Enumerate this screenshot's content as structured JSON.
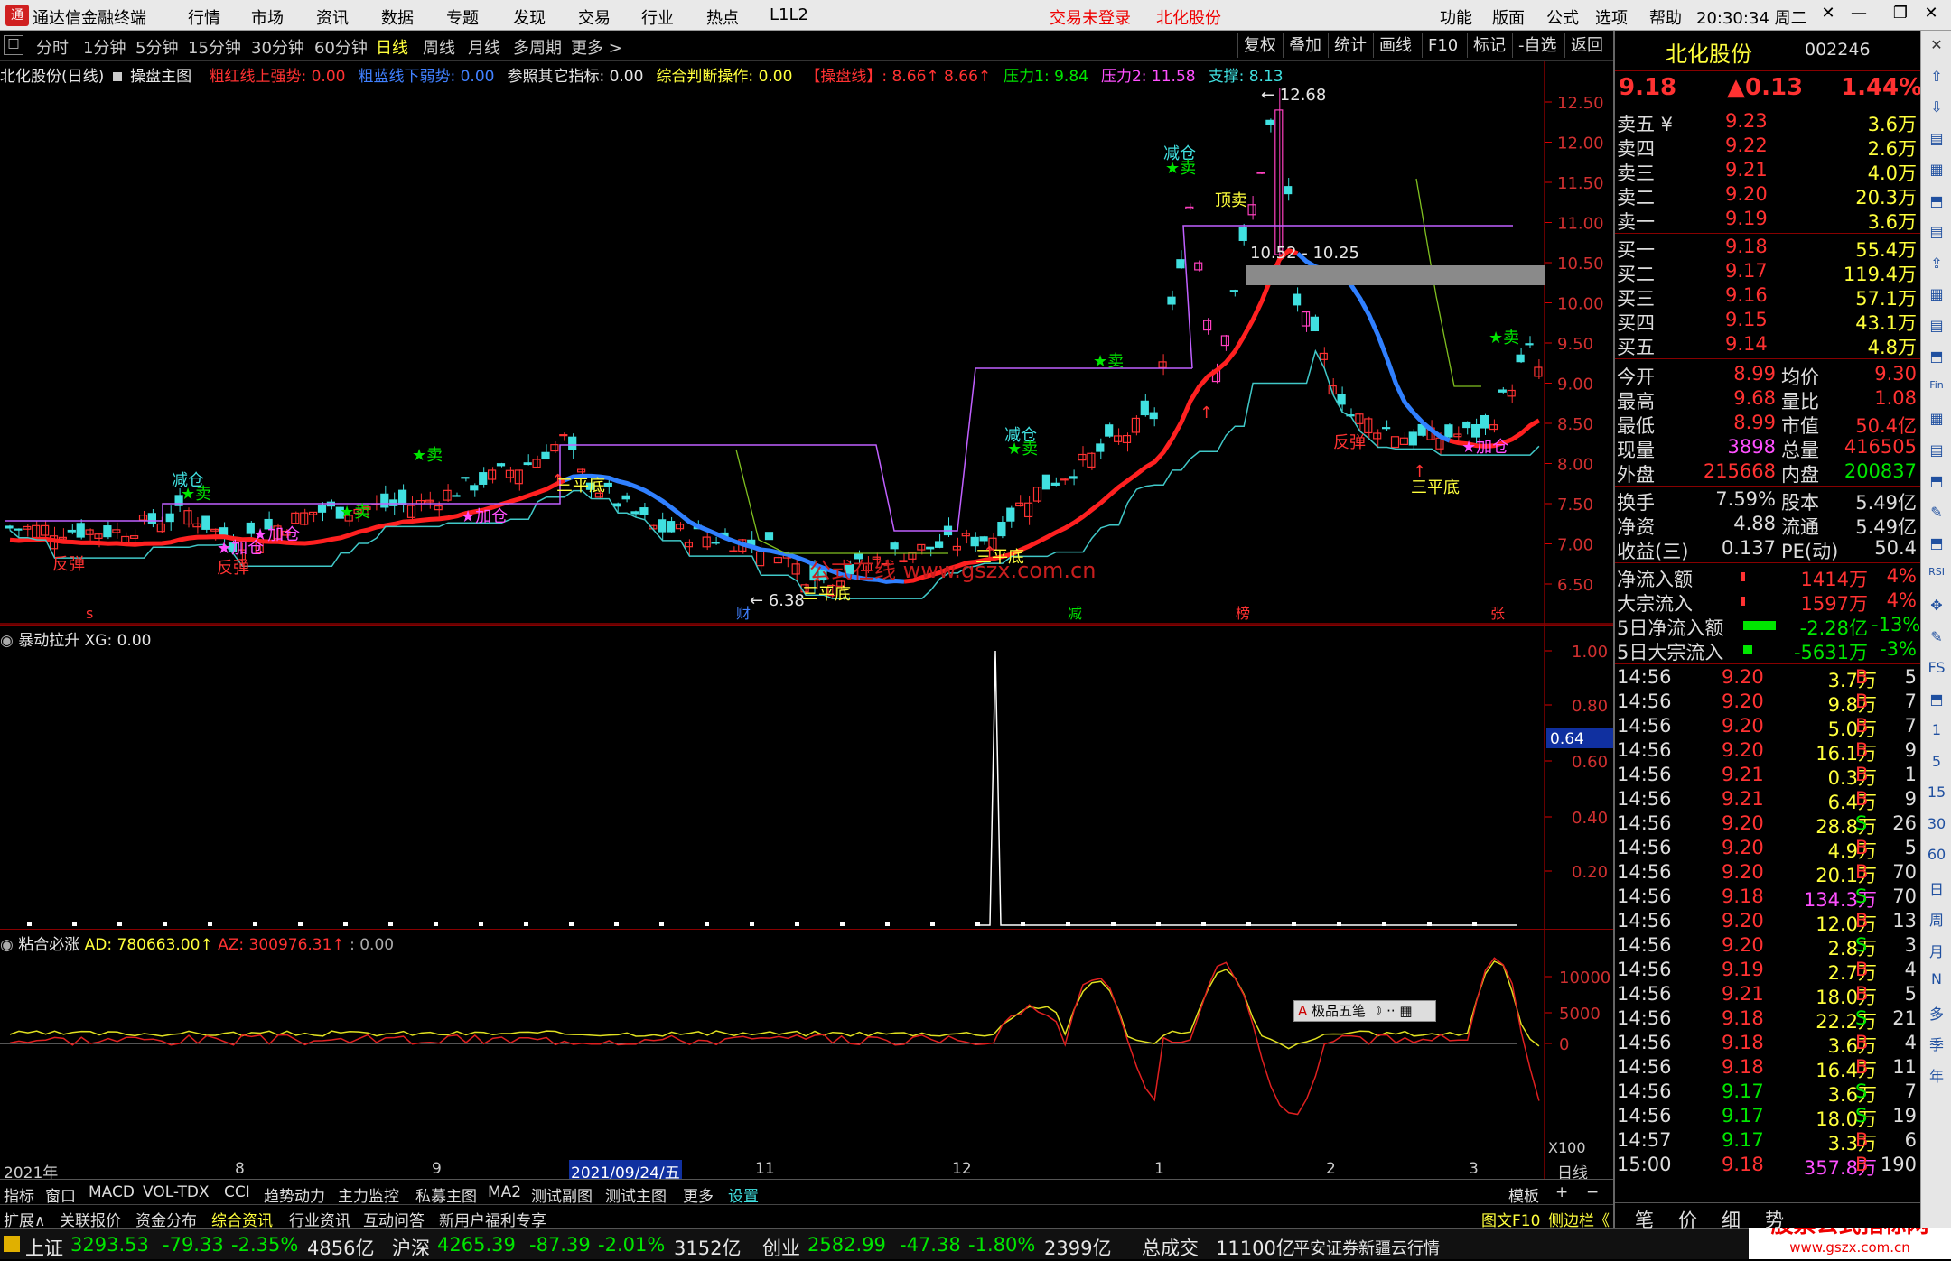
{
  "menubar": {
    "app_title": "通达信金融终端",
    "menus": [
      "行情",
      "市场",
      "资讯",
      "数据",
      "专题",
      "发现",
      "交易",
      "行业",
      "热点",
      "L1L2"
    ],
    "login_status": "交易未登录",
    "stock_name": "北化股份",
    "right_menus": [
      "功能",
      "版面",
      "公式",
      "选项",
      "帮助"
    ],
    "clock": "20:30:34",
    "weekday": "周二"
  },
  "toolbar": {
    "periods": [
      "分时",
      "1分钟",
      "5分钟",
      "15分钟",
      "30分钟",
      "60分钟",
      "日线",
      "周线",
      "月线",
      "多周期",
      "更多 >"
    ],
    "selected": "日线",
    "right_buttons": [
      "复权",
      "叠加",
      "统计",
      "画线",
      "F10",
      "标记",
      "-自选",
      "返回"
    ]
  },
  "main": {
    "stock_label": "北化股份(日线)",
    "formula": "操盘主图",
    "legend": [
      {
        "text": "粗红线上强势: 0.00",
        "color": "#ff3232"
      },
      {
        "text": "粗蓝线下弱势: 0.00",
        "color": "#4080ff"
      },
      {
        "text": "参照其它指标: 0.00",
        "color": "#e6e6e6"
      },
      {
        "text": "综合判断操作: 0.00",
        "color": "#ffff3c"
      },
      {
        "text": "【操盘线】: 8.66↑  8.66↑",
        "color": "#ff3232"
      },
      {
        "text": "压力1: 9.84",
        "color": "#00e600"
      },
      {
        "text": "压力2: 11.58",
        "color": "#ff50ff"
      },
      {
        "text": "支撑: 8.13",
        "color": "#40e0e0"
      }
    ],
    "yticks": [
      "12.50",
      "12.00",
      "11.50",
      "11.00",
      "10.50",
      "10.00",
      "9.50",
      "9.00",
      "8.50",
      "8.00",
      "7.50",
      "7.00",
      "6.50"
    ],
    "high_label": "12.68",
    "low_label": "6.38",
    "zone_label": "10.52 - 10.25",
    "watermark": "公式在线  www.gszx.com.cn",
    "annotations": [
      {
        "t": "减仓",
        "c": "#40e0e0"
      },
      {
        "t": "★卖",
        "c": "#00e600"
      },
      {
        "t": "反弹",
        "c": "#ff3232"
      },
      {
        "t": "★加仓",
        "c": "#ff50ff"
      },
      {
        "t": "★加仓",
        "c": "#ff50ff"
      },
      {
        "t": "反弹",
        "c": "#ff3232"
      },
      {
        "t": "★卖",
        "c": "#00e600"
      },
      {
        "t": "★卖",
        "c": "#00e600"
      },
      {
        "t": "★加仓",
        "c": "#ff50ff"
      },
      {
        "t": "三平底",
        "c": "#ffff3c"
      },
      {
        "t": "三平底",
        "c": "#ffff3c"
      },
      {
        "t": "三平底",
        "c": "#ffff3c"
      },
      {
        "t": "减仓",
        "c": "#40e0e0"
      },
      {
        "t": "★卖",
        "c": "#00e600"
      },
      {
        "t": "★卖",
        "c": "#00e600"
      },
      {
        "t": "减仓",
        "c": "#40e0e0"
      },
      {
        "t": "★卖",
        "c": "#00e600"
      },
      {
        "t": "顶卖",
        "c": "#ffff3c"
      },
      {
        "t": "反弹",
        "c": "#ff3232"
      },
      {
        "t": "三平底",
        "c": "#ffff3c"
      },
      {
        "t": "★加仓",
        "c": "#ff50ff"
      },
      {
        "t": "★卖",
        "c": "#00e600"
      }
    ],
    "markers": [
      {
        "t": "s",
        "c": "#ff3232"
      },
      {
        "t": "财",
        "c": "#4080ff"
      },
      {
        "t": "减",
        "c": "#00e600"
      },
      {
        "t": "榜",
        "c": "#ff3232"
      },
      {
        "t": "张",
        "c": "#ff3232"
      }
    ]
  },
  "ind1": {
    "title": "暴动拉升",
    "value": "XG: 0.00",
    "yticks": [
      "1.00",
      "0.80",
      "0.60",
      "0.40",
      "0.20"
    ],
    "cursor_value": "0.64"
  },
  "ind2": {
    "title": "粘合必涨",
    "ad": "AD: 780663.00↑",
    "az": "AZ: 300976.31↑",
    "extra": ": 0.00",
    "yticks": [
      "10000",
      "5000",
      "0"
    ],
    "scale": "X100",
    "ime": "极品五笔"
  },
  "dateaxis": {
    "labels": [
      "2021年",
      "8",
      "9",
      "2021/09/24/五",
      "11",
      "12",
      "1",
      "2",
      "3"
    ],
    "period": "日线"
  },
  "tabs": [
    "指标",
    "窗口",
    "MACD",
    "VOL-TDX",
    "CCI",
    "趋势动力",
    "主力监控",
    "私募主图",
    "MA2",
    "测试副图",
    "测试主图",
    "更多",
    "设置"
  ],
  "tabs_right": [
    "模板",
    "+",
    "−"
  ],
  "ext": [
    "扩展∧",
    "关联报价",
    "资金分布",
    "综合资讯",
    "行业资讯",
    "互动问答",
    "新用户福利专享"
  ],
  "ext_right": [
    "图文F10",
    "侧边栏《"
  ],
  "status": [
    {
      "n": "上证",
      "v": "3293.53",
      "ch": "-79.33",
      "pct": "-2.35%",
      "amt": "4856亿"
    },
    {
      "n": "沪深",
      "v": "4265.39",
      "ch": "-87.39",
      "pct": "-2.01%",
      "amt": "3152亿"
    },
    {
      "n": "创业",
      "v": "2582.99",
      "ch": "-47.38",
      "pct": "-1.80%",
      "amt": "2399亿"
    }
  ],
  "status_extra": {
    "label": "总成交",
    "value": "11100亿",
    "broker": "平安证券新疆云行情",
    "ad": "股票公式指标网",
    "ad_url": "www.gszx.com.cn"
  },
  "quote": {
    "name": "北化股份",
    "code": "002246",
    "price": "9.18",
    "change": "▲0.13",
    "pct": "1.44%",
    "sells": [
      {
        "l": "卖五 ¥",
        "p": "9.23",
        "v": "3.6万"
      },
      {
        "l": "卖四",
        "p": "9.22",
        "v": "2.6万"
      },
      {
        "l": "卖三",
        "p": "9.21",
        "v": "4.0万"
      },
      {
        "l": "卖二",
        "p": "9.20",
        "v": "20.3万"
      },
      {
        "l": "卖一",
        "p": "9.19",
        "v": "3.6万"
      }
    ],
    "buys": [
      {
        "l": "买一",
        "p": "9.18",
        "v": "55.4万"
      },
      {
        "l": "买二",
        "p": "9.17",
        "v": "119.4万"
      },
      {
        "l": "买三",
        "p": "9.16",
        "v": "57.1万"
      },
      {
        "l": "买四",
        "p": "9.15",
        "v": "43.1万"
      },
      {
        "l": "买五",
        "p": "9.14",
        "v": "4.8万"
      }
    ],
    "stats": [
      [
        "今开",
        "8.99",
        "均价",
        "9.30"
      ],
      [
        "最高",
        "9.68",
        "量比",
        "1.08"
      ],
      [
        "最低",
        "8.99",
        "市值",
        "50.4亿"
      ],
      [
        "现量",
        "3898",
        "总量",
        "416505"
      ],
      [
        "外盘",
        "215668",
        "内盘",
        "200837"
      ],
      [
        "换手",
        "7.59%",
        "股本",
        "5.49亿"
      ],
      [
        "净资",
        "4.88",
        "流通",
        "5.49亿"
      ],
      [
        "收益(三)",
        "0.137",
        "PE(动)",
        "50.4"
      ]
    ],
    "flows": [
      {
        "l": "净流入额",
        "v": "1414万",
        "p": "4%"
      },
      {
        "l": "大宗流入",
        "v": "1597万",
        "p": "4%"
      },
      {
        "l": "5日净流入额",
        "v": "-2.28亿",
        "p": "-13%"
      },
      {
        "l": "5日大宗流入",
        "v": "-5631万",
        "p": "-3%"
      }
    ],
    "ticks": [
      [
        "14:56",
        "9.20",
        "3.7万",
        "B",
        "5"
      ],
      [
        "14:56",
        "9.20",
        "9.8万",
        "B",
        "7"
      ],
      [
        "14:56",
        "9.20",
        "5.0万",
        "B",
        "7"
      ],
      [
        "14:56",
        "9.20",
        "16.1万",
        "B",
        "9"
      ],
      [
        "14:56",
        "9.21",
        "0.3万",
        "B",
        "1"
      ],
      [
        "14:56",
        "9.21",
        "6.4万",
        "B",
        "9"
      ],
      [
        "14:56",
        "9.20",
        "28.8万",
        "S",
        "26"
      ],
      [
        "14:56",
        "9.20",
        "4.9万",
        "B",
        "5"
      ],
      [
        "14:56",
        "9.20",
        "20.1万",
        "B",
        "70"
      ],
      [
        "14:56",
        "9.18",
        "134.3万",
        "S",
        "70"
      ],
      [
        "14:56",
        "9.20",
        "12.0万",
        "B",
        "13"
      ],
      [
        "14:56",
        "9.20",
        "2.8万",
        "S",
        "3"
      ],
      [
        "14:56",
        "9.19",
        "2.7万",
        "B",
        "4"
      ],
      [
        "14:56",
        "9.21",
        "18.0万",
        "B",
        "5"
      ],
      [
        "14:56",
        "9.18",
        "22.2万",
        "S",
        "21"
      ],
      [
        "14:56",
        "9.18",
        "3.6万",
        "B",
        "4"
      ],
      [
        "14:56",
        "9.18",
        "16.4万",
        "B",
        "11"
      ],
      [
        "14:56",
        "9.17",
        "3.6万",
        "S",
        "7"
      ],
      [
        "14:56",
        "9.17",
        "18.0万",
        "S",
        "19"
      ],
      [
        "14:57",
        "9.17",
        "3.3万",
        "B",
        "6"
      ],
      [
        "15:00",
        "9.18",
        "357.8万",
        "B",
        "190"
      ]
    ],
    "bottom_tabs": [
      "笔",
      "价",
      "细",
      "势"
    ]
  },
  "sidebar": [
    "✕",
    "⇧",
    "⇩",
    "▤",
    "▦",
    "⬒",
    "▤",
    "⇪",
    "▦",
    "▤",
    "⬒",
    "Fin",
    "▦",
    "▤",
    "⬒",
    "✎",
    "⬒",
    "RSI",
    "✥",
    "✎",
    "FS",
    "⬒",
    "1",
    "5",
    "15",
    "30",
    "60",
    "日",
    "周",
    "月",
    "N",
    "多",
    "季",
    "年"
  ]
}
